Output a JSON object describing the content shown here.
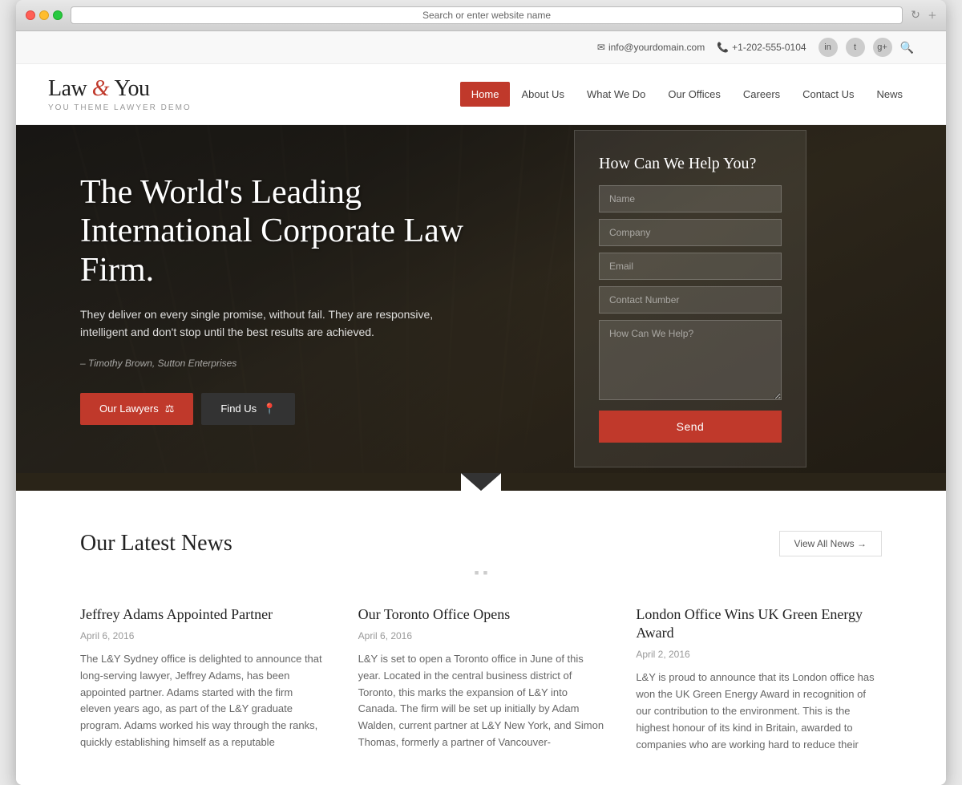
{
  "browser": {
    "address": "Search or enter website name"
  },
  "topbar": {
    "email": "info@yourdomain.com",
    "phone": "+1-202-555-0104",
    "linkedin": "in",
    "twitter": "t",
    "googleplus": "g+"
  },
  "logo": {
    "main_part1": "Law",
    "ampersand": "&",
    "main_part2": "You",
    "subtitle": "YOU THEME LAWYER DEMO"
  },
  "nav": {
    "items": [
      {
        "label": "Home",
        "active": true
      },
      {
        "label": "About Us",
        "active": false
      },
      {
        "label": "What We Do",
        "active": false
      },
      {
        "label": "Our Offices",
        "active": false
      },
      {
        "label": "Careers",
        "active": false
      },
      {
        "label": "Contact Us",
        "active": false
      },
      {
        "label": "News",
        "active": false
      }
    ]
  },
  "hero": {
    "title": "The World's Leading International Corporate Law Firm.",
    "subtitle": "They deliver on every single promise, without fail. They are responsive, intelligent and don't stop until the best results are achieved.",
    "quote": "– Timothy Brown, Sutton Enterprises",
    "btn_lawyers": "Our Lawyers",
    "btn_findus": "Find Us",
    "form_title": "How Can We Help You?",
    "form_name_placeholder": "Name",
    "form_company_placeholder": "Company",
    "form_email_placeholder": "Email",
    "form_phone_placeholder": "Contact Number",
    "form_message_placeholder": "How Can We Help?",
    "btn_send": "Send"
  },
  "news": {
    "section_title": "Our Latest News",
    "btn_view_all": "View All News →",
    "items": [
      {
        "title": "Jeffrey Adams Appointed Partner",
        "date": "April 6, 2016",
        "text": "The L&Y Sydney office is delighted to announce that long-serving lawyer, Jeffrey Adams, has been appointed partner. Adams started with the firm eleven years ago, as part of the L&Y graduate program. Adams worked his way through the ranks, quickly establishing himself as a reputable"
      },
      {
        "title": "Our Toronto Office Opens",
        "date": "April 6, 2016",
        "text": "L&Y is set to open a Toronto office in June of this year. Located in the central business district of Toronto, this marks the expansion of L&Y into Canada. The firm will be set up initially by Adam Walden, current partner at L&Y New York, and Simon Thomas, formerly a partner of Vancouver-"
      },
      {
        "title": "London Office Wins UK Green Energy Award",
        "date": "April 2, 2016",
        "text": "L&Y is proud to announce that its London office has won the UK Green Energy Award in recognition of our contribution to the environment. This is the highest honour of its kind in Britain, awarded to companies who are working hard to reduce their"
      }
    ]
  }
}
